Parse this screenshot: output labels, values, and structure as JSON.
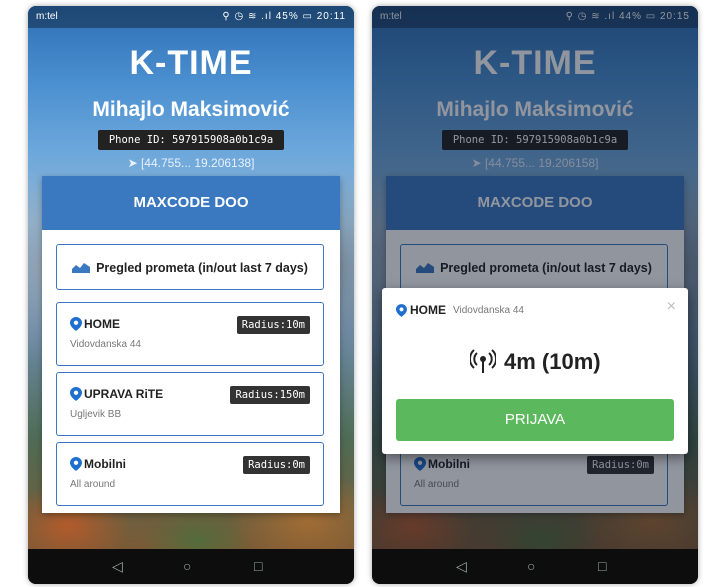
{
  "left": {
    "status": {
      "carrier": "m:tel",
      "icons": "⚲ ◷ ≋ .ıl 45% ▭ 20:11"
    },
    "app_title": "K-TIME",
    "user_name": "Mihajlo Maksimović",
    "phone_id": "Phone ID: 597915908a0b1c9a",
    "coords": "[44.755... 19.206138]",
    "company": "MAXCODE DOO",
    "stats_button": "Pregled prometa (in/out last 7 days)",
    "locations": [
      {
        "name": "HOME",
        "address": "Vidovdanska 44",
        "radius": "Radius:10m"
      },
      {
        "name": "UPRAVA RiTE",
        "address": "Ugljevik BB",
        "radius": "Radius:150m"
      },
      {
        "name": "Mobilni",
        "address": "All around",
        "radius": "Radius:0m"
      }
    ]
  },
  "right": {
    "status": {
      "carrier": "m:tel",
      "icons": "⚲ ◷ ≋ .ıl 44% ▭ 20:15"
    },
    "app_title": "K-TIME",
    "user_name": "Mihajlo Maksimović",
    "phone_id": "Phone ID: 597915908a0b1c9a",
    "coords": "[44.755... 19.206158]",
    "company": "MAXCODE DOO",
    "stats_button": "Pregled prometa (in/out last 7 days)",
    "locations_bg": [
      {
        "name": "Mobilni",
        "address": "All around",
        "radius": "Radius:0m"
      }
    ],
    "modal": {
      "name": "HOME",
      "address": "Vidovdanska 44",
      "close": "×",
      "distance": "4m (10m)",
      "checkin_label": "PRIJAVA"
    }
  },
  "nav": {
    "back": "◁",
    "home": "○",
    "recents": "□"
  },
  "colors": {
    "primary": "#3a78c0",
    "success": "#5cb85c",
    "badge": "#333333"
  },
  "icons": {
    "pin": "map-pin-icon",
    "chart": "area-chart-icon",
    "signal": "signal-tower-icon",
    "close": "close-icon"
  }
}
